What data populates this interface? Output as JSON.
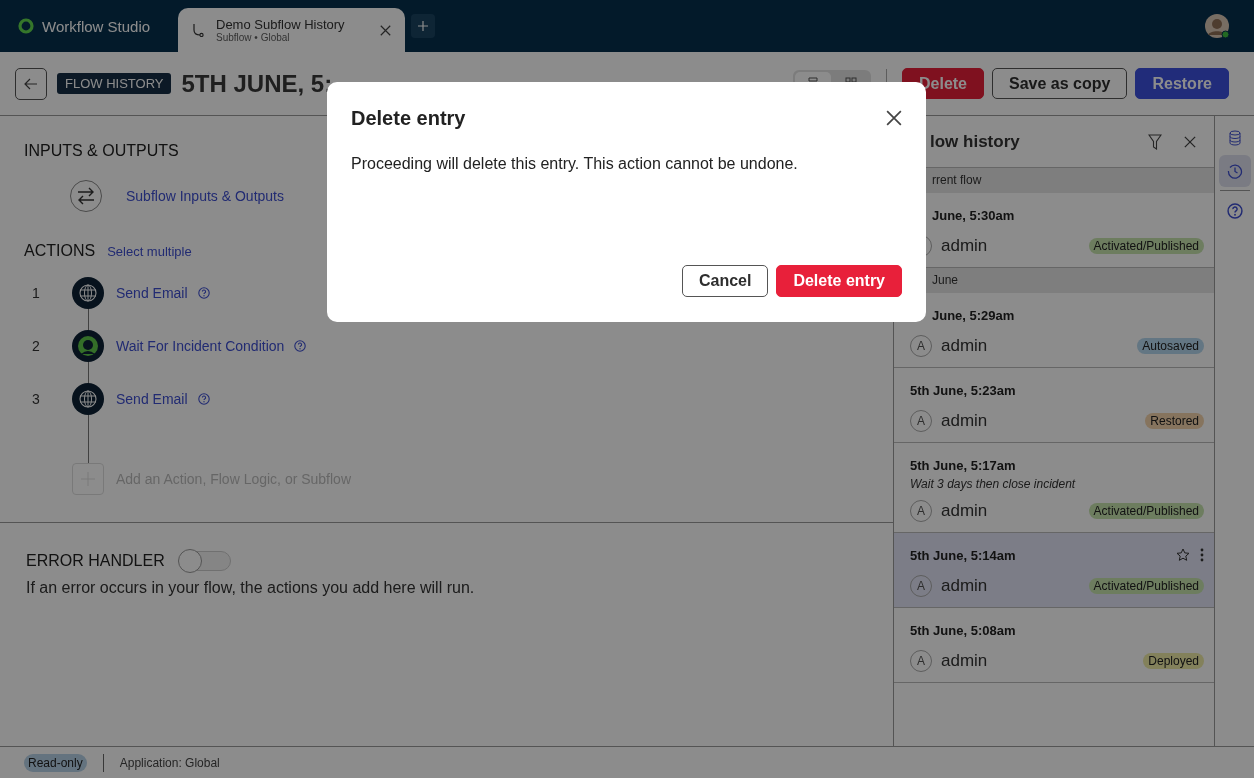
{
  "app": {
    "name": "Workflow Studio"
  },
  "tabs": [
    {
      "title": "Demo Subflow History",
      "subtitle": "Subflow • Global",
      "selected": true
    }
  ],
  "header": {
    "badge": "FLOW HISTORY",
    "title": "5TH JUNE, 5:",
    "view_toggle": [
      {
        "kind": "list",
        "selected": true
      },
      {
        "kind": "diagram",
        "selected": false
      }
    ],
    "buttons": [
      {
        "label": "Delete",
        "kind": "danger"
      },
      {
        "label": "Save as copy",
        "kind": "secondary"
      },
      {
        "label": "Restore",
        "kind": "primary"
      }
    ]
  },
  "inputs_outputs": {
    "heading": "INPUTS & OUTPUTS",
    "link": "Subflow Inputs & Outputs"
  },
  "actions": {
    "heading": "ACTIONS",
    "select_link": "Select multiple",
    "items": [
      {
        "number": "1",
        "label": "Send Email",
        "kind": "globe"
      },
      {
        "number": "2",
        "label": "Wait For Incident Condition",
        "kind": "wait"
      },
      {
        "number": "3",
        "label": "Send Email",
        "kind": "globe"
      }
    ],
    "add_placeholder": "Add an Action, Flow Logic, or Subflow"
  },
  "error_handler": {
    "heading": "ERROR HANDLER",
    "on": false,
    "description": "If an error occurs in your flow, the actions you add here will run."
  },
  "history": {
    "title": "low history",
    "groups": [
      {
        "label": "rrent flow",
        "entries": [
          {
            "time": "June, 5:30am",
            "user": "admin",
            "status": "Activated/Published",
            "color": "#6d7d5f",
            "selected": false
          }
        ]
      },
      {
        "label": "June",
        "entries": [
          {
            "time": "June, 5:29am",
            "avatar": "A",
            "user": "admin",
            "status": "Autosaved",
            "color": "#637683",
            "selected": false
          },
          {
            "time": "5th June, 5:23am",
            "avatar": "A",
            "user": "admin",
            "status": "Restored",
            "color": "#86745e",
            "selected": false
          },
          {
            "time": "5th June, 5:17am",
            "note": "Wait 3 days then close incident",
            "avatar": "A",
            "user": "admin",
            "status": "Activated/Published",
            "color": "#6d7d5f",
            "selected": false
          },
          {
            "time": "5th June, 5:14am",
            "avatar": "A",
            "user": "admin",
            "status": "Activated/Published",
            "color": "#6d7d5f",
            "selected": true
          },
          {
            "time": "5th June, 5:08am",
            "avatar": "A",
            "user": "admin",
            "status": "Deployed",
            "color": "#83815c",
            "selected": false
          }
        ]
      }
    ]
  },
  "rail": [
    {
      "kind": "database",
      "selected": false
    },
    {
      "kind": "history",
      "selected": true
    },
    {
      "kind": "help",
      "selected": false
    }
  ],
  "status_bar": {
    "badge": "Read-only",
    "application": "Application: Global"
  },
  "dialog": {
    "title": "Delete entry",
    "message": "Proceeding will delete this entry. This action cannot be undone.",
    "buttons": [
      {
        "label": "Cancel",
        "kind": "secondary"
      },
      {
        "label": "Delete entry",
        "kind": "danger"
      }
    ]
  }
}
